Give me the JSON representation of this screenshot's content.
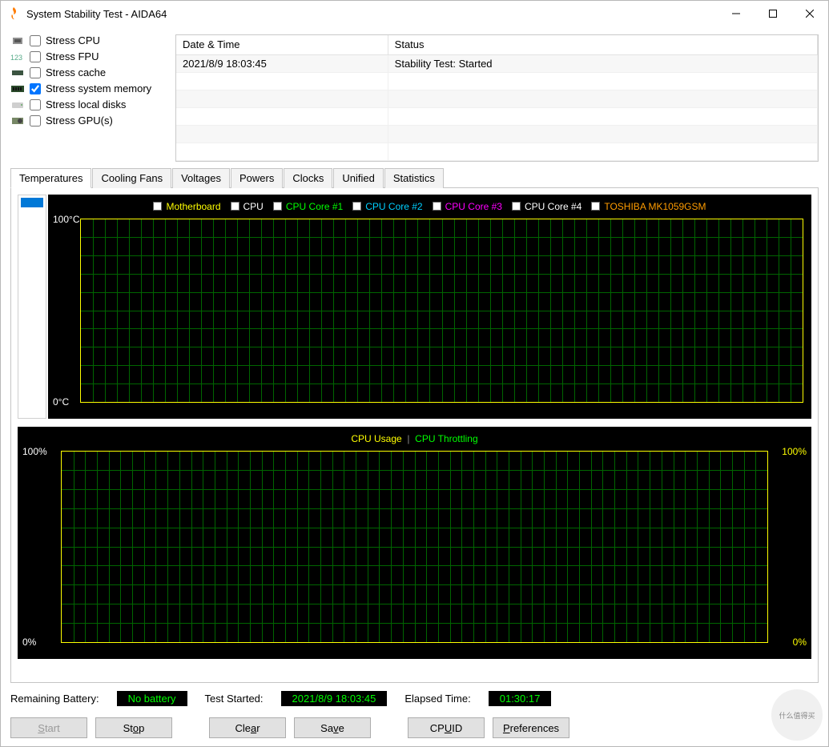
{
  "window": {
    "title": "System Stability Test - AIDA64"
  },
  "checks": [
    {
      "label": "Stress CPU",
      "checked": false
    },
    {
      "label": "Stress FPU",
      "checked": false
    },
    {
      "label": "Stress cache",
      "checked": false
    },
    {
      "label": "Stress system memory",
      "checked": true
    },
    {
      "label": "Stress local disks",
      "checked": false
    },
    {
      "label": "Stress GPU(s)",
      "checked": false
    }
  ],
  "log": {
    "headers": {
      "dt": "Date & Time",
      "status": "Status"
    },
    "rows": [
      {
        "dt": "2021/8/9 18:03:45",
        "status": "Stability Test: Started"
      }
    ]
  },
  "tabs": [
    "Temperatures",
    "Cooling Fans",
    "Voltages",
    "Powers",
    "Clocks",
    "Unified",
    "Statistics"
  ],
  "active_tab": 0,
  "chart_data": [
    {
      "type": "line",
      "title": "",
      "ylabel_top": "100°C",
      "ylabel_bottom": "0°C",
      "ylim": [
        0,
        100
      ],
      "series": [
        {
          "name": "Motherboard",
          "color": "#ffff00",
          "values": []
        },
        {
          "name": "CPU",
          "color": "#ffffff",
          "values": []
        },
        {
          "name": "CPU Core #1",
          "color": "#00ff00",
          "values": []
        },
        {
          "name": "CPU Core #2",
          "color": "#00d0ff",
          "values": []
        },
        {
          "name": "CPU Core #3",
          "color": "#ff00ff",
          "values": []
        },
        {
          "name": "CPU Core #4",
          "color": "#ffffff",
          "values": []
        },
        {
          "name": "TOSHIBA MK1059GSM",
          "color": "#ff9c00",
          "values": []
        }
      ]
    },
    {
      "type": "line",
      "title_left": "CPU Usage",
      "title_right": "CPU Throttling",
      "ylabel_top_left": "100%",
      "ylabel_bottom_left": "0%",
      "ylabel_top_right": "100%",
      "ylabel_bottom_right": "0%",
      "ylim": [
        0,
        100
      ],
      "series": [
        {
          "name": "CPU Usage",
          "color": "#ffff00",
          "values": []
        },
        {
          "name": "CPU Throttling",
          "color": "#00ff00",
          "values": []
        }
      ]
    }
  ],
  "status": {
    "battery_label": "Remaining Battery:",
    "battery_value": "No battery",
    "started_label": "Test Started:",
    "started_value": "2021/8/9 18:03:45",
    "elapsed_label": "Elapsed Time:",
    "elapsed_value": "01:30:17"
  },
  "buttons": {
    "start": "Start",
    "stop": "Stop",
    "clear": "Clear",
    "save": "Save",
    "cpuid": "CPUID",
    "prefs": "Preferences"
  },
  "watermark": "什么值得买"
}
